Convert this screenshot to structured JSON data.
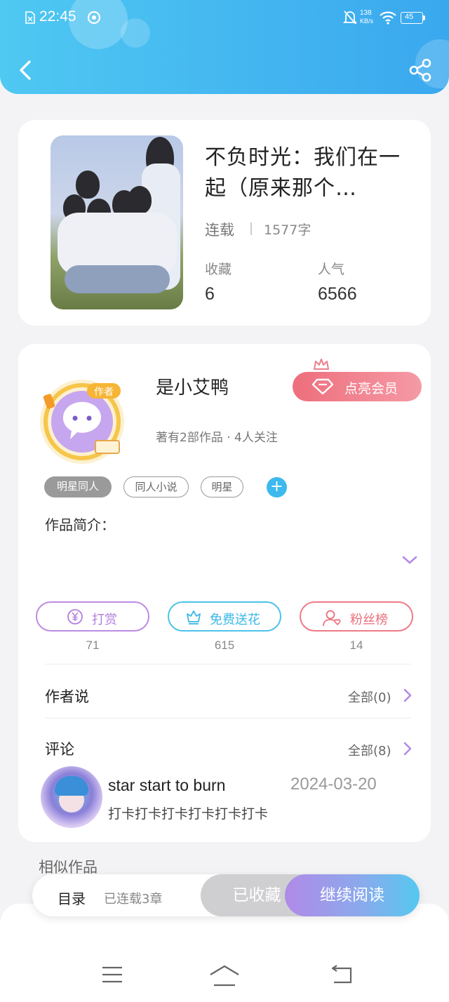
{
  "status_bar": {
    "time": "22:45",
    "net_speed_value": "138",
    "net_speed_unit": "KB/s",
    "battery": "45"
  },
  "header": {
    "back_icon": "chevron-left-icon",
    "share_icon": "share-icon",
    "accent_colors": [
      "#4fc8f2",
      "#3aa8ee"
    ]
  },
  "book": {
    "title": "不负时光：我们在一起（原来那个…",
    "status": "连载",
    "word_count": "1577字",
    "favorites_label": "收藏",
    "favorites_value": "6",
    "popularity_label": "人气",
    "popularity_value": "6566"
  },
  "author": {
    "badge_text": "作者",
    "name": "是小艾鸭",
    "subtitle": "著有2部作品 · 4人关注",
    "vip_button": "点亮会员",
    "tags": [
      "明星同人",
      "同人小说",
      "明星"
    ],
    "add_tag": "+",
    "intro_label": "作品简介："
  },
  "actions": [
    {
      "label": "打赏",
      "count": "71",
      "icon": "yen-coin-icon",
      "color": "#b888e0"
    },
    {
      "label": "免费送花",
      "count": "615",
      "icon": "flower-icon",
      "color": "#4cc3ea"
    },
    {
      "label": "粉丝榜",
      "count": "14",
      "icon": "fan-user-icon",
      "color": "#ee7a86"
    }
  ],
  "author_says": {
    "title": "作者说",
    "more": "全部(0)"
  },
  "comments": {
    "title": "评论",
    "more": "全部(8)",
    "items": [
      {
        "user": "star start to burn",
        "date": "2024-03-20",
        "text": "打卡打卡打卡打卡打卡打卡"
      }
    ]
  },
  "similar": {
    "title": "相似作品"
  },
  "read_bar": {
    "toc_label": "目录",
    "toc_sub": "已连载3章",
    "favorited_button": "已收藏",
    "continue_button": "继续阅读"
  },
  "system_nav": {
    "menu_icon": "menu-icon",
    "home_icon": "home-icon",
    "back_icon": "back-icon"
  }
}
